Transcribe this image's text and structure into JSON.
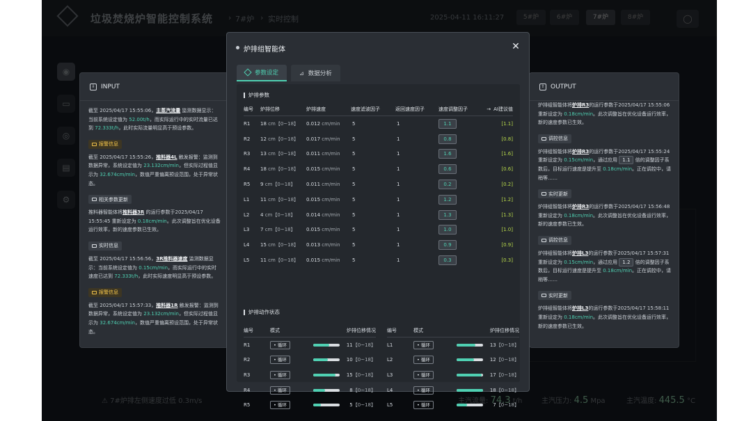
{
  "background": {
    "title": "垃圾焚烧炉智能控制系统",
    "breadcrumb": [
      "7#炉",
      "实时控制"
    ],
    "datetime": "2025-04-11 16:11:27",
    "tabs": [
      "5#炉",
      "6#炉",
      "7#炉",
      "8#炉"
    ],
    "active_tab": "7#炉",
    "status_alarm": "7#炉排左侧速度过低 0.3m/s",
    "status": [
      {
        "label": "主汽流量:",
        "value": "74.3",
        "unit": "t/h"
      },
      {
        "label": "主汽压力:",
        "value": "4.5",
        "unit": "Mpa"
      },
      {
        "label": "主汽温度:",
        "value": "445.5",
        "unit": "°C"
      }
    ]
  },
  "input_panel": {
    "title": "INPUT",
    "messages": [
      {
        "type": "text",
        "parts": [
          "截至 2025/04/17 15:55:06，",
          {
            "u": "主蒸汽流量"
          },
          " 监测数据显示：当前系统设定值为 ",
          {
            "g": "52.00t/h"
          },
          "，而实际运行中的实时流量已达到 ",
          {
            "g": "72.333t/h"
          },
          "，此时实际流量明显高于预设参数。"
        ]
      },
      {
        "type": "tag",
        "style": "warn",
        "label": "报警信息"
      },
      {
        "type": "text",
        "parts": [
          "截至 2025/04/17 15:55:26，",
          {
            "u": "推料器4L"
          },
          " 触发报警：监测到数据异常，系统设定值为 ",
          {
            "g": "23.132cm/min"
          },
          "，但实际过程值显示为 ",
          {
            "g": "32.674cm/min"
          },
          "，数值严重偏离预设范围，处于异常状态。"
        ]
      },
      {
        "type": "tag",
        "style": "upd",
        "label": "相关参数更新"
      },
      {
        "type": "text",
        "parts": [
          "推料器智能体将",
          {
            "u": "推料器3R"
          },
          " 的运行参数于2025/04/17 15:55:45 重新设定为 ",
          {
            "g": "0.18cm/min"
          },
          "。此次调整旨在优化设备运行效率，新的速度参数已生效。"
        ]
      },
      {
        "type": "tag",
        "style": "info",
        "label": "实时信息"
      },
      {
        "type": "text",
        "parts": [
          "截至 2025/04/17 15:56:56，",
          {
            "u": "3R推料器速度"
          },
          " 监测数据显示：当前系统设定值为 ",
          {
            "g": "0.15cm/min"
          },
          "，而实际运行中的实时速度已达到 ",
          {
            "g": "72.333t/h"
          },
          "，此时实际速度明显高于预设参数。"
        ]
      },
      {
        "type": "tag",
        "style": "warn",
        "label": "报警信息"
      },
      {
        "type": "text",
        "parts": [
          "截至 2025/04/17 15:57:33，",
          {
            "u": "推料器1R"
          },
          " 触发报警：监测到数据异常，系统设定值为 ",
          {
            "g": "23.132cm/min"
          },
          "，但实际过程值显示为 ",
          {
            "g": "32.674cm/min"
          },
          "，数值严重偏离预设范围，处于异常状态。"
        ]
      }
    ]
  },
  "output_panel": {
    "title": "OUTPUT",
    "messages": [
      {
        "type": "text",
        "parts": [
          "炉排组智能体将",
          {
            "u": "炉排R3"
          },
          "的运行参数于2025/04/17 15:55:06 重新设定为 ",
          {
            "g": "0.18cm/min"
          },
          "。此次调整旨在优化设备运行效率，新的速度参数已生效。"
        ]
      },
      {
        "type": "tag",
        "style": "info",
        "label": "调控信息"
      },
      {
        "type": "text",
        "parts": [
          "炉排组智能体将",
          {
            "u": "炉排R3"
          },
          "的运行参数于2025/04/17 15:55:24 重新设定为 ",
          {
            "g": "0.15cm/min"
          },
          "，通过应用 ",
          {
            "p": "1.1"
          },
          " 倍的调整因子系数后，目标运行速度是提升至 ",
          {
            "g": "0.18cm/min"
          },
          "。正在调控中，请稍等……"
        ]
      },
      {
        "type": "tag",
        "style": "upd",
        "label": "实时更新"
      },
      {
        "type": "text",
        "parts": [
          "炉排组智能体将",
          {
            "u": "炉排R3"
          },
          "的运行参数于2025/04/17 15:56:48 重新设定为 ",
          {
            "g": "0.18cm/min"
          },
          "。此次调整旨在优化设备运行效率，新的速度参数已生效。"
        ]
      },
      {
        "type": "tag",
        "style": "info",
        "label": "调控信息"
      },
      {
        "type": "text",
        "parts": [
          "炉排组智能体将",
          {
            "u": "炉排L3"
          },
          "的运行参数于2025/04/17 15:57:31 重新设定为 ",
          {
            "g": "0.15cm/min"
          },
          "，通过应用 ",
          {
            "p": "1.2"
          },
          " 倍的调整因子系数后，目标运行速度是提升至 ",
          {
            "g": "0.18cm/min"
          },
          "。正在调控中，请稍等……"
        ]
      },
      {
        "type": "tag",
        "style": "upd",
        "label": "实时更新"
      },
      {
        "type": "text",
        "parts": [
          "炉排组智能体将",
          {
            "u": "炉排L3"
          },
          "的运行参数于2025/04/17 15:58:11 重新设定为 ",
          {
            "g": "0.18cm/min"
          },
          "。此次调整旨在优化设备运行效率，新的速度参数已生效。"
        ]
      }
    ]
  },
  "modal": {
    "title": "炉排组智能体",
    "close": "✕",
    "tabs": [
      {
        "label": "参数设定",
        "active": true
      },
      {
        "label": "数据分析",
        "active": false
      }
    ],
    "param_section": "炉排参数",
    "param_headers": [
      "编号",
      "炉排位移",
      "炉排速度",
      "速度滤波因子",
      "返回速度因子",
      "速度调整因子",
      "AI建议值"
    ],
    "params": [
      {
        "id": "R1",
        "disp": "18",
        "speed": "0.012",
        "filter": "5",
        "ret": "1",
        "adj": "1.1",
        "ai": "[1.1]"
      },
      {
        "id": "R2",
        "disp": "12",
        "speed": "0.017",
        "filter": "5",
        "ret": "1",
        "adj": "0.8",
        "ai": "[0.8]"
      },
      {
        "id": "R3",
        "disp": "13",
        "speed": "0.011",
        "filter": "5",
        "ret": "1",
        "adj": "1.6",
        "ai": "[1.6]"
      },
      {
        "id": "R4",
        "disp": "18",
        "speed": "0.015",
        "filter": "5",
        "ret": "1",
        "adj": "0.6",
        "ai": "[0.6]"
      },
      {
        "id": "R5",
        "disp": "9",
        "speed": "0.011",
        "filter": "5",
        "ret": "1",
        "adj": "0.2",
        "ai": "[0.2]"
      },
      {
        "id": "L1",
        "disp": "11",
        "speed": "0.015",
        "filter": "5",
        "ret": "1",
        "adj": "1.2",
        "ai": "[1.2]"
      },
      {
        "id": "L2",
        "disp": "4",
        "speed": "0.014",
        "filter": "5",
        "ret": "1",
        "adj": "1.3",
        "ai": "[1.3]"
      },
      {
        "id": "L3",
        "disp": "7",
        "speed": "0.015",
        "filter": "5",
        "ret": "1",
        "adj": "1.0",
        "ai": "[1.0]"
      },
      {
        "id": "L4",
        "disp": "15",
        "speed": "0.013",
        "filter": "5",
        "ret": "1",
        "adj": "0.9",
        "ai": "[0.9]"
      },
      {
        "id": "L5",
        "disp": "11",
        "speed": "0.015",
        "filter": "5",
        "ret": "1",
        "adj": "0.3",
        "ai": "[0.3]"
      }
    ],
    "disp_unit": "cm",
    "disp_range": "【0~18】",
    "speed_unit": "cm/min",
    "action_section": "炉排动作状态",
    "action_headers": [
      "编号",
      "模式",
      "炉排位移情况"
    ],
    "actions_left": [
      {
        "id": "R1",
        "mode": "• 循环",
        "value": 11
      },
      {
        "id": "R2",
        "mode": "• 循环",
        "value": 10
      },
      {
        "id": "R3",
        "mode": "• 循环",
        "value": 15
      },
      {
        "id": "R4",
        "mode": "• 循环",
        "value": 8
      },
      {
        "id": "R5",
        "mode": "• 循环",
        "value": 5
      }
    ],
    "actions_right": [
      {
        "id": "L1",
        "mode": "• 循环",
        "value": 13
      },
      {
        "id": "L2",
        "mode": "• 循环",
        "value": 12
      },
      {
        "id": "L3",
        "mode": "• 循环",
        "value": 17
      },
      {
        "id": "L4",
        "mode": "• 循环",
        "value": 18
      },
      {
        "id": "L5",
        "mode": "• 循环",
        "value": 7
      }
    ],
    "action_range": "【0~18】",
    "action_max": 18,
    "accent": "#4fd0b2"
  }
}
